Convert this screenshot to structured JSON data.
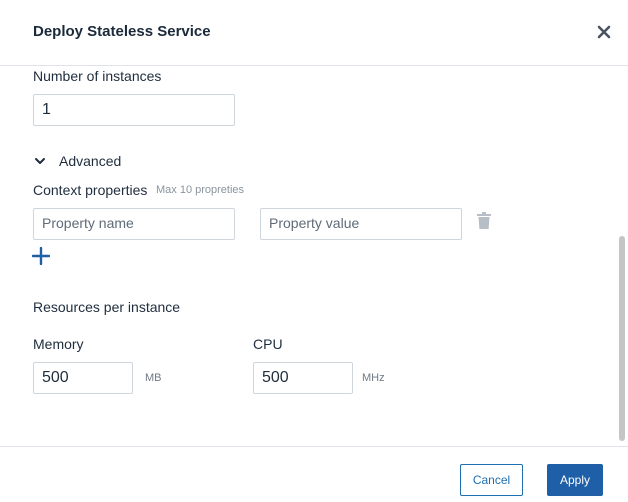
{
  "dialog": {
    "title": "Deploy Stateless Service",
    "close_icon": "close-icon"
  },
  "instances": {
    "label": "Number of instances",
    "value": "1"
  },
  "advanced": {
    "label": "Advanced",
    "expanded": true,
    "icon": "chevron-down-icon"
  },
  "context_properties": {
    "label": "Context properties",
    "hint": "Max 10 propreties",
    "name_placeholder": "Property name",
    "value_placeholder": "Property value",
    "delete_icon": "trash-icon",
    "add_icon": "plus-icon"
  },
  "resources": {
    "label": "Resources per instance",
    "memory": {
      "label": "Memory",
      "value": "500",
      "unit": "MB"
    },
    "cpu": {
      "label": "CPU",
      "value": "500",
      "unit": "MHz"
    }
  },
  "footer": {
    "cancel_label": "Cancel",
    "apply_label": "Apply"
  },
  "colors": {
    "accent": "#1e5fa8",
    "border": "#dfe3e8",
    "text": "#1f2d3d"
  }
}
